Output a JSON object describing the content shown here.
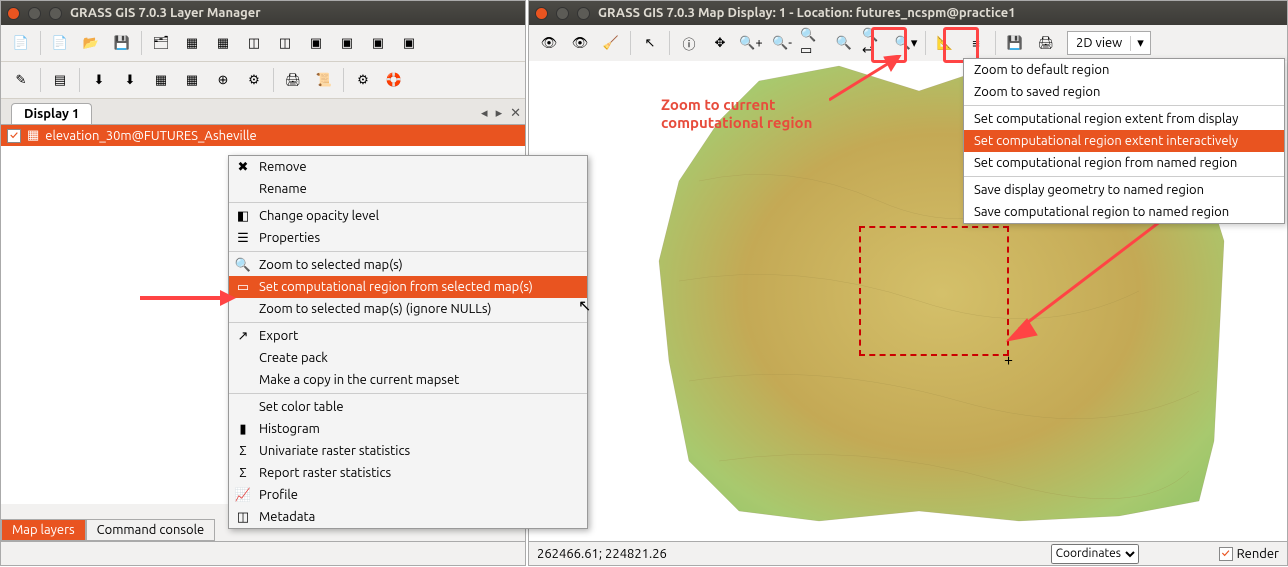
{
  "layer_window": {
    "title": "GRASS GIS 7.0.3 Layer Manager",
    "display_tab": "Display 1",
    "layer_name": "elevation_30m@FUTURES_Asheville",
    "bottom_tabs": [
      "Map layers",
      "Command console"
    ]
  },
  "context_menu": {
    "items": [
      {
        "label": "Remove",
        "icon": "✖"
      },
      {
        "label": "Rename"
      },
      {
        "sep": true
      },
      {
        "label": "Change opacity level",
        "icon": "◧"
      },
      {
        "label": "Properties",
        "icon": "☰"
      },
      {
        "sep": true
      },
      {
        "label": "Zoom to selected map(s)",
        "icon": "🔍"
      },
      {
        "label": "Set computational region from selected map(s)",
        "icon": "▭",
        "selected": true
      },
      {
        "label": "Zoom to selected map(s) (ignore NULLs)"
      },
      {
        "sep": true
      },
      {
        "label": "Export",
        "icon": "↗"
      },
      {
        "label": "Create pack"
      },
      {
        "label": "Make a copy in the current mapset"
      },
      {
        "sep": true
      },
      {
        "label": "Set color table"
      },
      {
        "label": "Histogram",
        "icon": "▮"
      },
      {
        "label": "Univariate raster statistics",
        "icon": "Σ"
      },
      {
        "label": "Report raster statistics",
        "icon": "Σ"
      },
      {
        "label": "Profile",
        "icon": "📈"
      },
      {
        "label": "Metadata",
        "icon": "◫"
      }
    ]
  },
  "map_window": {
    "title": "GRASS GIS 7.0.3 Map Display: 1  - Location: futures_ncspm@practice1",
    "view_mode": "2D view",
    "coords": "262466.61; 224821.26",
    "status_select": "Coordinates",
    "render_label": "Render"
  },
  "region_menu": {
    "items": [
      {
        "label": "Zoom to default region"
      },
      {
        "label": "Zoom to saved region"
      },
      {
        "sep": true
      },
      {
        "label": "Set computational region extent from display"
      },
      {
        "label": "Set computational region extent interactively",
        "selected": true
      },
      {
        "label": "Set computational region from named region"
      },
      {
        "sep": true
      },
      {
        "label": "Save display geometry to named region"
      },
      {
        "label": "Save computational region to named region"
      }
    ]
  },
  "annotation": {
    "zoom_label": "Zoom to current computational region"
  }
}
